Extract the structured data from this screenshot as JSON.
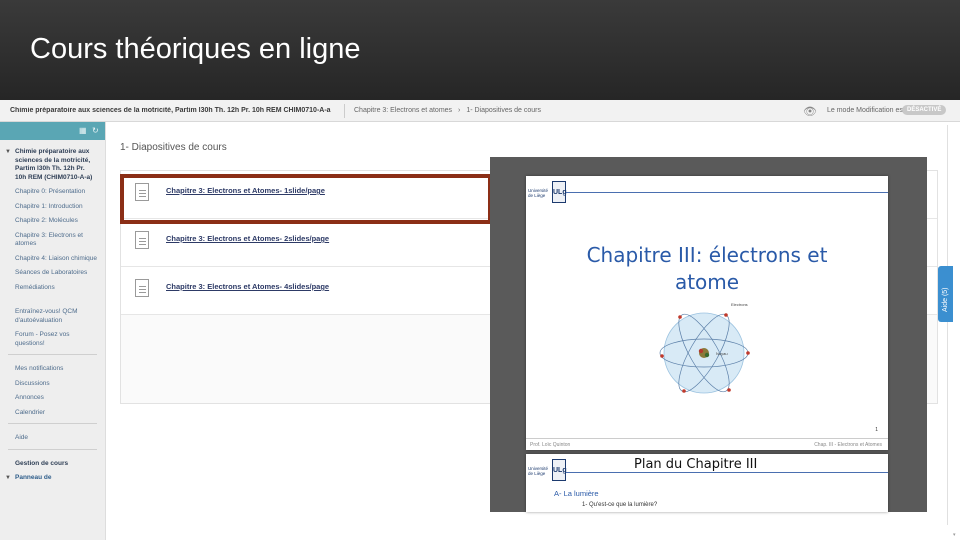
{
  "slide": {
    "title": "Cours théoriques en ligne"
  },
  "topbar": {
    "course_title": "Chimie préparatoire aux sciences de la motricité, Partim I30h Th. 12h Pr. 10h REM CHIM0710-A-a",
    "breadcrumb": [
      "Chapitre 3: Electrons et atomes",
      "›",
      "1- Diapositives de cours"
    ],
    "edit_mode_label": "Le mode Modification est",
    "edit_mode_state": "DÉSACTIVÉ"
  },
  "sidebar": {
    "course": "Chimie préparatoire aux sciences de la motricité, Partim I30h Th. 12h Pr. 10h REM (CHIM0710-A-a)",
    "items": [
      "Chapitre 0: Présentation",
      "Chapitre 1: Introduction",
      "Chapitre 2: Molécules",
      "Chapitre 3: Electrons et atomes",
      "Chapitre 4: Liaison chimique",
      "Séances de Laboratoires",
      "Remédiations",
      "Entraînez-vous! QCM d'autoévaluation",
      "Forum - Posez vos questions!"
    ],
    "items2": [
      "Mes notifications",
      "Discussions",
      "Annonces",
      "Calendrier"
    ],
    "items3": [
      "Aide"
    ],
    "section": "Gestion de cours",
    "panel": "Panneau de"
  },
  "main": {
    "heading": "1- Diapositives de cours",
    "files": [
      "Chapitre 3: Electrons et Atomes- 1slide/page",
      "Chapitre 3: Electrons et Atomes- 2slides/page",
      "Chapitre 3: Electrons et Atomes- 4slides/page"
    ]
  },
  "help": {
    "label": "Aide (5)"
  },
  "pdf": {
    "logo_text": "Université de Liège",
    "logo_mark": "ULg",
    "page1": {
      "title_line1": "Chapitre III: électrons et",
      "title_line2": "atome",
      "label_electrons": "Electrons",
      "label_noyau": "Noyau",
      "number": "1",
      "footer_left": "Prof. Loïc Quinton",
      "footer_right": "Chap. III - Electrons et Atomes"
    },
    "page2": {
      "title": "Plan du Chapitre III",
      "section": "A- La lumière",
      "sub": "1- Qu'est-ce que la lumière?"
    }
  }
}
